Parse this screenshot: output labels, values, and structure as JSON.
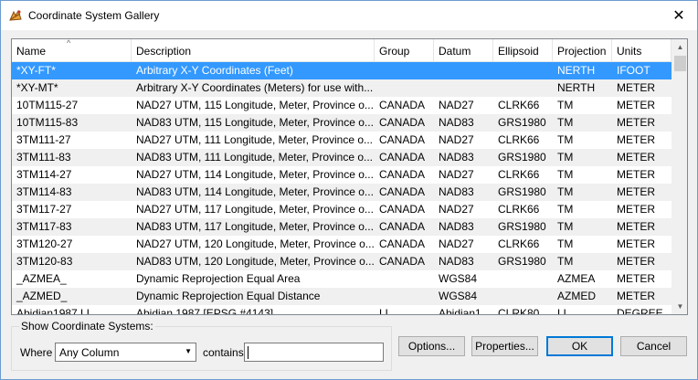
{
  "window": {
    "title": "Coordinate System Gallery",
    "close_glyph": "✕"
  },
  "columns": {
    "name": "Name",
    "description": "Description",
    "group": "Group",
    "datum": "Datum",
    "ellipsoid": "Ellipsoid",
    "projection": "Projection",
    "units": "Units",
    "sort_glyph": "^"
  },
  "rows": [
    {
      "name": "*XY-FT*",
      "description": "Arbitrary X-Y Coordinates (Feet)",
      "group": "",
      "datum": "",
      "ellipsoid": "",
      "projection": "NERTH",
      "units": "IFOOT"
    },
    {
      "name": "*XY-MT*",
      "description": "Arbitrary X-Y Coordinates (Meters) for use with...",
      "group": "",
      "datum": "",
      "ellipsoid": "",
      "projection": "NERTH",
      "units": "METER"
    },
    {
      "name": "10TM115-27",
      "description": "NAD27 UTM, 115 Longitude, Meter, Province o...",
      "group": "CANADA",
      "datum": "NAD27",
      "ellipsoid": "CLRK66",
      "projection": "TM",
      "units": "METER"
    },
    {
      "name": "10TM115-83",
      "description": "NAD83 UTM, 115 Longitude, Meter, Province o...",
      "group": "CANADA",
      "datum": "NAD83",
      "ellipsoid": "GRS1980",
      "projection": "TM",
      "units": "METER"
    },
    {
      "name": "3TM111-27",
      "description": "NAD27 UTM, 111 Longitude, Meter, Province o...",
      "group": "CANADA",
      "datum": "NAD27",
      "ellipsoid": "CLRK66",
      "projection": "TM",
      "units": "METER"
    },
    {
      "name": "3TM111-83",
      "description": "NAD83 UTM, 111 Longitude, Meter, Province o...",
      "group": "CANADA",
      "datum": "NAD83",
      "ellipsoid": "GRS1980",
      "projection": "TM",
      "units": "METER"
    },
    {
      "name": "3TM114-27",
      "description": "NAD27 UTM, 114 Longitude, Meter, Province o...",
      "group": "CANADA",
      "datum": "NAD27",
      "ellipsoid": "CLRK66",
      "projection": "TM",
      "units": "METER"
    },
    {
      "name": "3TM114-83",
      "description": "NAD83 UTM, 114 Longitude, Meter, Province o...",
      "group": "CANADA",
      "datum": "NAD83",
      "ellipsoid": "GRS1980",
      "projection": "TM",
      "units": "METER"
    },
    {
      "name": "3TM117-27",
      "description": "NAD27 UTM, 117 Longitude, Meter, Province o...",
      "group": "CANADA",
      "datum": "NAD27",
      "ellipsoid": "CLRK66",
      "projection": "TM",
      "units": "METER"
    },
    {
      "name": "3TM117-83",
      "description": "NAD83 UTM, 117 Longitude, Meter, Province o...",
      "group": "CANADA",
      "datum": "NAD83",
      "ellipsoid": "GRS1980",
      "projection": "TM",
      "units": "METER"
    },
    {
      "name": "3TM120-27",
      "description": "NAD27 UTM, 120 Longitude, Meter, Province o...",
      "group": "CANADA",
      "datum": "NAD27",
      "ellipsoid": "CLRK66",
      "projection": "TM",
      "units": "METER"
    },
    {
      "name": "3TM120-83",
      "description": "NAD83 UTM, 120 Longitude, Meter, Province o...",
      "group": "CANADA",
      "datum": "NAD83",
      "ellipsoid": "GRS1980",
      "projection": "TM",
      "units": "METER"
    },
    {
      "name": "_AZMEA_",
      "description": "Dynamic Reprojection Equal Area",
      "group": "",
      "datum": "WGS84",
      "ellipsoid": "",
      "projection": "AZMEA",
      "units": "METER"
    },
    {
      "name": "_AZMED_",
      "description": "Dynamic Reprojection Equal Distance",
      "group": "",
      "datum": "WGS84",
      "ellipsoid": "",
      "projection": "AZMED",
      "units": "METER"
    },
    {
      "name": "Abidian1987.LL",
      "description": "Abidian 1987 [EPSG #4143]",
      "group": "LL",
      "datum": "Abidian1",
      "ellipsoid": "CLRK80",
      "projection": "LL",
      "units": "DEGREE"
    }
  ],
  "selected_row": 0,
  "filter": {
    "group_label": "Show Coordinate Systems:",
    "where_label": "Where",
    "column_selected": "Any Column",
    "contains_label": "contains",
    "contains_value": ""
  },
  "buttons": {
    "options": "Options...",
    "properties": "Properties...",
    "ok": "OK",
    "cancel": "Cancel"
  },
  "scrollbar": {
    "up_glyph": "▲",
    "down_glyph": "▼"
  },
  "colors": {
    "selection": "#3399ff",
    "alt_row": "#f0f0f0",
    "default_button_border": "#0078d7"
  }
}
